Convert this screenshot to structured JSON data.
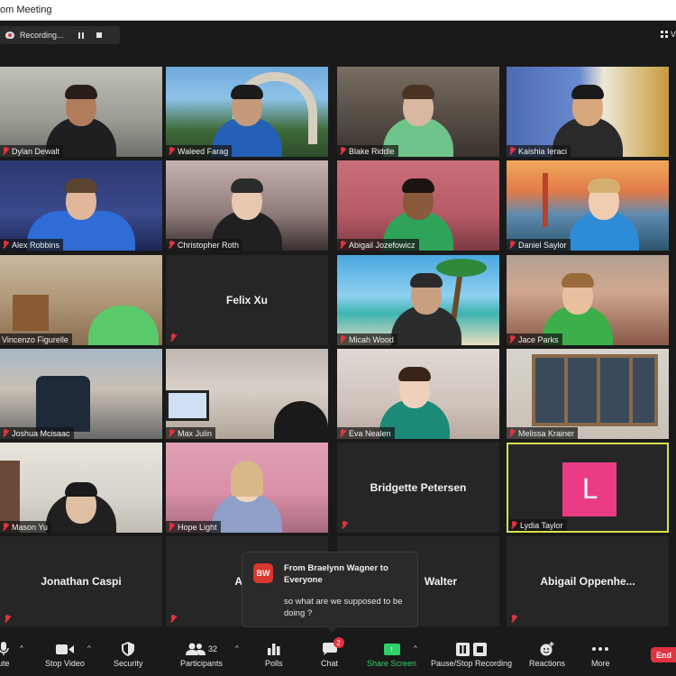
{
  "window": {
    "title": "om Meeting"
  },
  "recording": {
    "label": "Recording..."
  },
  "view": {
    "label": "V"
  },
  "tiles": [
    {
      "name": "Dylan Dewalt"
    },
    {
      "name": "Waleed Farag"
    },
    {
      "name": "Blake Riddle"
    },
    {
      "name": "Kaishia Ieraci"
    },
    {
      "name": "Alex Robbins"
    },
    {
      "name": "Christopher Roth"
    },
    {
      "name": "Abigail Jozefowicz"
    },
    {
      "name": "Daniel Saylor"
    },
    {
      "name": "Vincenzo Figurelle"
    },
    {
      "name": "Felix Xu"
    },
    {
      "name": "Micah Wood"
    },
    {
      "name": "Jace Parks"
    },
    {
      "name": "Joshua Mcisaac"
    },
    {
      "name": "Max Julin"
    },
    {
      "name": "Eva Nealen"
    },
    {
      "name": "Melissa Krainer"
    },
    {
      "name": "Mason Yu"
    },
    {
      "name": "Hope Light"
    },
    {
      "name": "Bridgette Petersen"
    },
    {
      "name": "Lydia Taylor",
      "avatar": "L"
    },
    {
      "name": "Jonathan Caspi"
    },
    {
      "name": "Ali C"
    },
    {
      "name": "Walter"
    },
    {
      "name": "Abigail  Oppenhe..."
    }
  ],
  "chat_popup": {
    "initials": "BW",
    "from": "From Braelynn Wagner to Everyone",
    "message": "so what are we supposed to be doing ?"
  },
  "toolbar": {
    "mute": "ute",
    "stop_video": "Stop Video",
    "security": "Security",
    "participants": "Participants",
    "participants_count": "32",
    "polls": "Polls",
    "chat": "Chat",
    "chat_badge": "2",
    "share_screen": "Share Screen",
    "pause_stop_recording": "Pause/Stop Recording",
    "reactions": "Reactions",
    "more": "More",
    "end": "End"
  }
}
